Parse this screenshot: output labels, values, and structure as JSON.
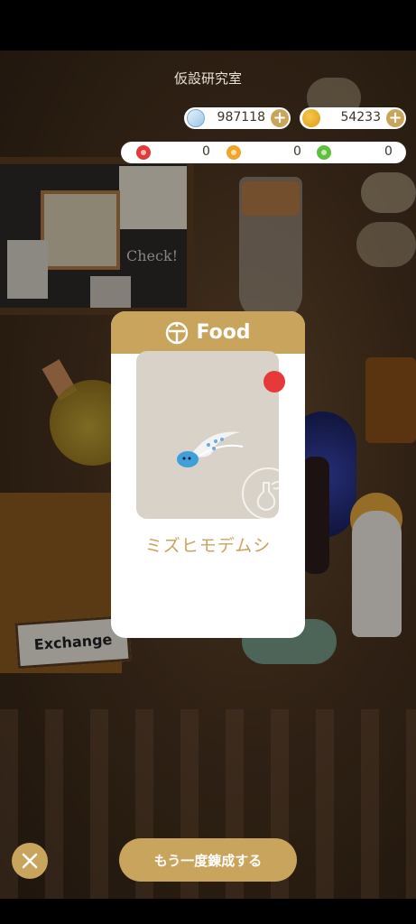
{
  "header": {
    "title": "仮設研究室"
  },
  "currencies": {
    "gems": {
      "icon": "diamond-icon",
      "value": "987118"
    },
    "coins": {
      "icon": "coin-icon",
      "value": "54233"
    }
  },
  "flowers": [
    {
      "icon": "red-flower-icon",
      "color": "#e23a3a",
      "value": "0"
    },
    {
      "icon": "orange-flower-icon",
      "color": "#f0a52a",
      "value": "0"
    },
    {
      "icon": "green-flower-icon",
      "color": "#5fbf3f",
      "value": "0"
    }
  ],
  "background": {
    "board_text": "Check!",
    "exchange_sign": "Exchange"
  },
  "modal": {
    "category_icon": "food-icon",
    "title": "Food",
    "item_name": "ミズヒモデムシ",
    "new_badge_color": "#e63a3a"
  },
  "buttons": {
    "close_icon": "close-icon",
    "retry_label": "もう一度錬成する"
  },
  "colors": {
    "accent": "#c9a45c",
    "modal_bg": "#ffffff",
    "card_bg": "#d8d2c8"
  }
}
